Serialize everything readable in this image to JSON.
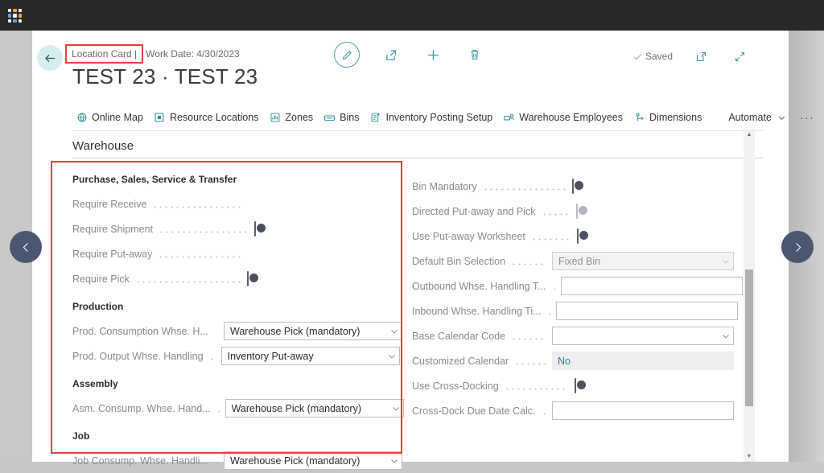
{
  "window": {
    "app_launcher": "app-launcher-waffle"
  },
  "header": {
    "back_label": "Back",
    "breadcrumb_highlight": "Location Card |",
    "breadcrumb_rest": "Work Date: 4/30/2023",
    "title": "TEST 23 · TEST 23",
    "actions": [
      {
        "name": "edit-button",
        "icon": "pencil-icon",
        "label": "Edit"
      },
      {
        "name": "share-button",
        "icon": "share-icon",
        "label": "Share"
      },
      {
        "name": "new-button",
        "icon": "plus-icon",
        "label": "New"
      },
      {
        "name": "delete-button",
        "icon": "trash-icon",
        "label": "Delete"
      }
    ],
    "saved_label": "Saved",
    "open_new_window_label": "Open in new window",
    "minimize_label": "Collapse"
  },
  "ribbon": {
    "items": [
      {
        "label": "Online Map",
        "icon": "globe-icon"
      },
      {
        "label": "Resource Locations",
        "icon": "resource-icon"
      },
      {
        "label": "Zones",
        "icon": "zones-icon"
      },
      {
        "label": "Bins",
        "icon": "bins-icon"
      },
      {
        "label": "Inventory Posting Setup",
        "icon": "posting-setup-icon"
      },
      {
        "label": "Warehouse Employees",
        "icon": "employees-icon"
      },
      {
        "label": "Dimensions",
        "icon": "dimensions-icon"
      }
    ],
    "automate_label": "Automate",
    "more_label": "More options"
  },
  "section": {
    "title": "Warehouse"
  },
  "left_column": {
    "groups": [
      {
        "title": "Purchase, Sales, Service & Transfer",
        "rows": [
          {
            "label": "Require Receive",
            "type": "toggle",
            "state": "on"
          },
          {
            "label": "Require Shipment",
            "type": "toggle",
            "state": "off"
          },
          {
            "label": "Require Put-away",
            "type": "toggle",
            "state": "on"
          },
          {
            "label": "Require Pick",
            "type": "toggle",
            "state": "off"
          }
        ]
      },
      {
        "title": "Production",
        "rows": [
          {
            "label": "Prod. Consumption Whse. H...",
            "type": "dropdown",
            "value": "Warehouse Pick (mandatory)"
          },
          {
            "label": "Prod. Output Whse. Handling",
            "type": "dropdown",
            "value": "Inventory Put-away"
          }
        ]
      },
      {
        "title": "Assembly",
        "rows": [
          {
            "label": "Asm. Consump. Whse. Hand...",
            "type": "dropdown",
            "value": "Warehouse Pick (mandatory)"
          }
        ]
      },
      {
        "title": "Job",
        "rows": [
          {
            "label": "Job Consump. Whse. Handli...",
            "type": "dropdown",
            "value": "Warehouse Pick (mandatory)"
          }
        ]
      }
    ]
  },
  "right_column": {
    "rows": [
      {
        "label": "Bin Mandatory",
        "type": "toggle",
        "state": "off"
      },
      {
        "label": "Directed Put-away and Pick",
        "type": "toggle",
        "state": "disabled"
      },
      {
        "label": "Use Put-away Worksheet",
        "type": "toggle",
        "state": "off"
      },
      {
        "label": "Default Bin Selection",
        "type": "dropdown",
        "value": "Fixed Bin",
        "disabled": true
      },
      {
        "label": "Outbound Whse. Handling T...",
        "type": "text",
        "value": ""
      },
      {
        "label": "Inbound Whse. Handling Ti...",
        "type": "text",
        "value": ""
      },
      {
        "label": "Base Calendar Code",
        "type": "dropdown",
        "value": ""
      },
      {
        "label": "Customized Calendar",
        "type": "flat",
        "value": "No"
      },
      {
        "label": "Use Cross-Docking",
        "type": "toggle",
        "state": "off"
      },
      {
        "label": "Cross-Dock Due Date Calc.",
        "type": "text",
        "value": ""
      }
    ]
  },
  "navigation": {
    "previous_label": "Previous record",
    "next_label": "Next record"
  },
  "scrollbar": {
    "up_label": "Scroll up",
    "down_label": "Scroll down"
  },
  "colors": {
    "accent_teal": "#0f8a86",
    "ribbon_icon": "#2e8f97",
    "annotation_red": "#ef3b3b",
    "nav_circle": "#4b5770",
    "link_teal": "#2b7f94"
  }
}
